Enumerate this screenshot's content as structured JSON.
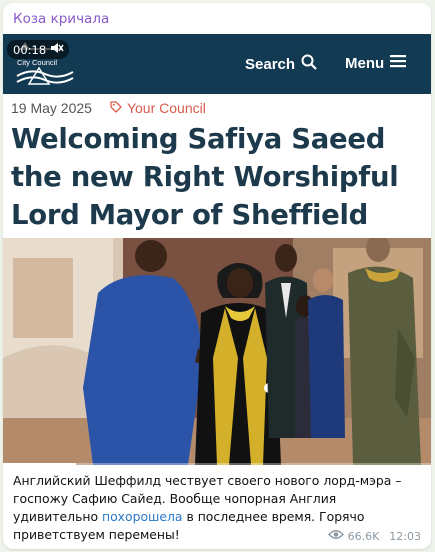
{
  "channel": {
    "name": "Коза кричала",
    "color": "#8a59c9"
  },
  "video": {
    "time": "00:18",
    "progress": 0.17,
    "header": {
      "logo_text": "City Council",
      "search_label": "Search",
      "menu_label": "Menu",
      "bg_color": "#123a52"
    },
    "date": "19 May 2025",
    "category": "Your Council",
    "headline": "Welcoming Safiya Saeed the new Right Worshipful Lord Mayor of Sheffield"
  },
  "caption": {
    "part1": "Английский Шеффилд чествует своего нового лорд-мэра – госпожу Сафию Сайед. Вообще чопорная Англия удивительно ",
    "link": "похорошела",
    "part2": " в последнее время. Горячо приветствуем перемены!"
  },
  "meta": {
    "views": "66.6K",
    "time": "12:03"
  }
}
